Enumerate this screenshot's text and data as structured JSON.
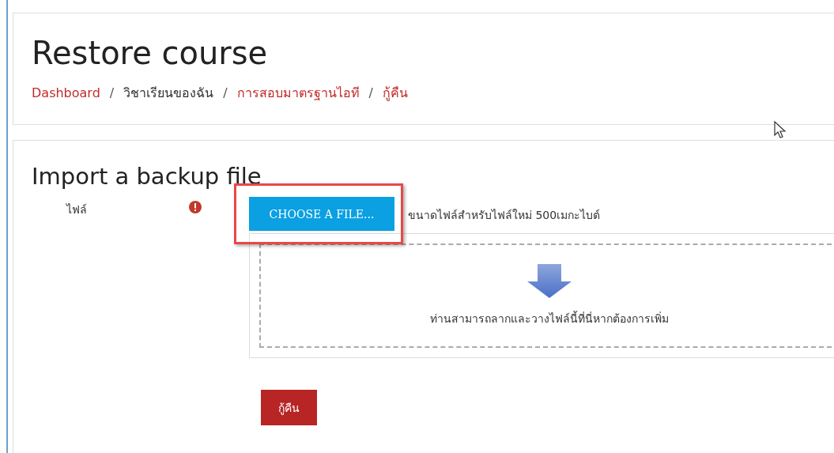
{
  "page": {
    "title": "Restore course"
  },
  "breadcrumb": [
    {
      "label": "Dashboard",
      "link": true
    },
    {
      "separator": "/",
      "label": "วิชาเรียนของฉัน",
      "link": false
    },
    {
      "separator": "/",
      "label": "การสอบมาตรฐานไอที",
      "link": true
    },
    {
      "separator": "/",
      "label": "กู้คืน",
      "link": true
    }
  ],
  "form": {
    "heading": "Import a backup file",
    "field_label": "ไฟล์",
    "required": true,
    "choose_button": "CHOOSE A FILE...",
    "highlighted": true,
    "size_note": "ขนาดไฟล์สำหรับไฟล์ใหม่ 500เมกะไบต์",
    "drop_hint": "ท่านสามารถลากและวางไฟล์นี้ที่นี่หากต้องการเพิ่ม",
    "submit": "กู้คืน"
  }
}
